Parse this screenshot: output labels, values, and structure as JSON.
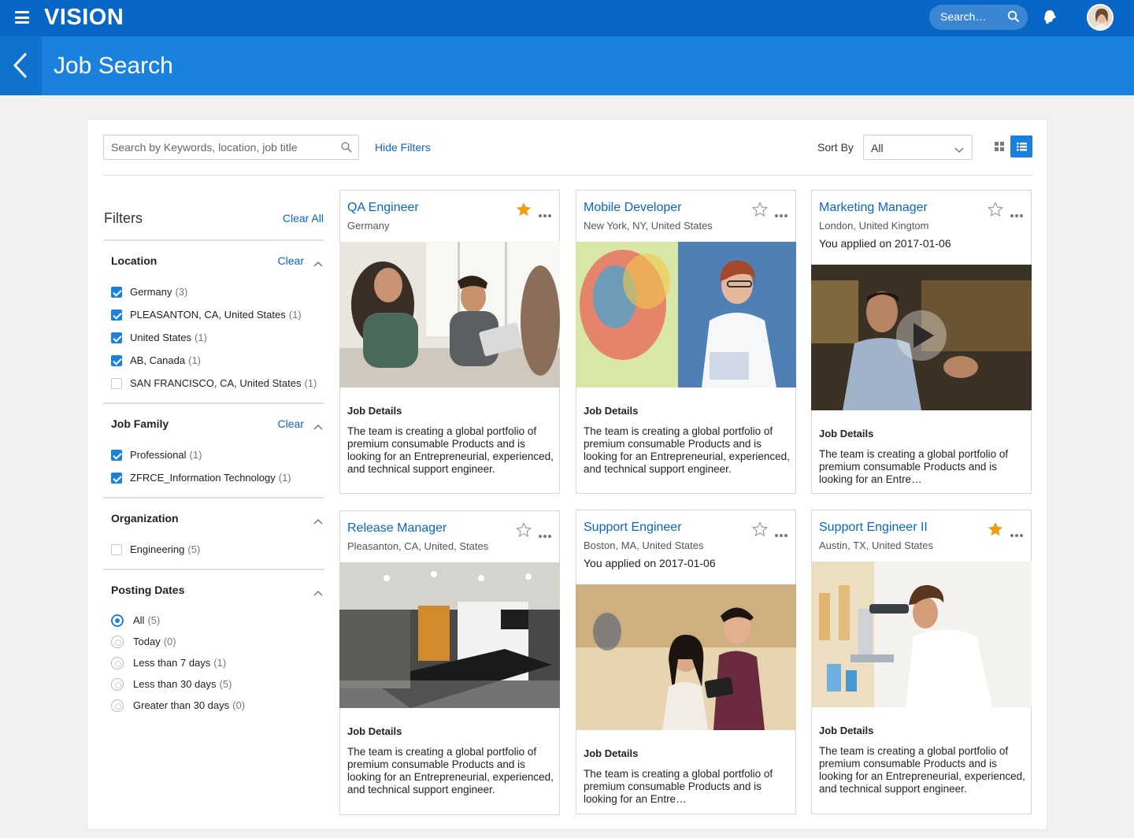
{
  "app": {
    "brand": "VISION",
    "search_label": "Search…",
    "page_title": "Job Search"
  },
  "toolbar": {
    "keyword_placeholder": "Search by Keywords, location, job title",
    "hide_filters": "Hide Filters",
    "sort_by_label": "Sort By",
    "sort_value": "All"
  },
  "filters": {
    "title": "Filters",
    "clear_all": "Clear All",
    "sections": [
      {
        "title": "Location",
        "clear": "Clear",
        "options": [
          {
            "label": "Germany",
            "count": "(3)",
            "checked": true
          },
          {
            "label": "PLEASANTON, CA, United States",
            "count": "(1)",
            "checked": true
          },
          {
            "label": "United States",
            "count": "(1)",
            "checked": true
          },
          {
            "label": "AB, Canada",
            "count": "(1)",
            "checked": true
          },
          {
            "label": "SAN FRANCISCO, CA, United States",
            "count": "(1)",
            "checked": false
          }
        ]
      },
      {
        "title": "Job Family",
        "clear": "Clear",
        "options": [
          {
            "label": "Professional",
            "count": "(1)",
            "checked": true
          },
          {
            "label": "ZFRCE_Information Technology",
            "count": "(1)",
            "checked": true
          }
        ]
      },
      {
        "title": "Organization",
        "options": [
          {
            "label": "Engineering",
            "count": "(5)",
            "checked": false
          }
        ]
      },
      {
        "title": "Posting Dates",
        "options": [
          {
            "label": "All",
            "count": "(5)",
            "checked": true
          },
          {
            "label": "Today",
            "count": "(0)",
            "checked": false
          },
          {
            "label": "Less than 7 days",
            "count": "(1)",
            "checked": false
          },
          {
            "label": "Less than 30 days",
            "count": "(5)",
            "checked": false
          },
          {
            "label": "Greater than 30 days",
            "count": "(0)",
            "checked": false
          }
        ]
      }
    ]
  },
  "jobs": [
    {
      "title": "QA Engineer",
      "location": "Germany",
      "favorite": true,
      "section": "Job Details",
      "description": "The team is creating a global portfolio of premium consumable Products and is looking for an Entrepreneurial, experienced, and technical support engineer."
    },
    {
      "title": "Mobile Developer",
      "location": "New York, NY, United States",
      "favorite": false,
      "section": "Job Details",
      "description": "The team is creating a global portfolio of premium consumable Products and is looking for an Entrepreneurial, experienced, and technical support engineer."
    },
    {
      "title": "Marketing Manager",
      "location": "London, United Kingtom",
      "applied": "You applied on 2017-01-06",
      "favorite": false,
      "section": "Job Details",
      "description": "The team is creating a global portfolio of premium consumable Products and is looking for an Entre…"
    },
    {
      "title": "Release Manager",
      "location": "Pleasanton, CA, United, States",
      "favorite": false,
      "section": "Job Details",
      "description": "The team is creating a global portfolio of premium consumable Products and is looking for an Entrepreneurial, experienced, and technical support engineer."
    },
    {
      "title": "Support Engineer",
      "location": "Boston, MA, United States",
      "applied": "You applied on 2017-01-06",
      "favorite": false,
      "section": "Job Details",
      "description": "The team is creating a global portfolio of premium consumable Products and is looking for an Entre…"
    },
    {
      "title": "Support Engineer II",
      "location": "Austin, TX, United States",
      "favorite": true,
      "section": "Job Details",
      "description": "The team is creating a global portfolio of premium consumable Products and is looking for an Entrepreneurial, experienced, and technical support engineer."
    }
  ],
  "colors": {
    "header": "#0867c6",
    "title_band": "#1a82de",
    "link": "#0867c6",
    "star_on": "#f39c12"
  }
}
